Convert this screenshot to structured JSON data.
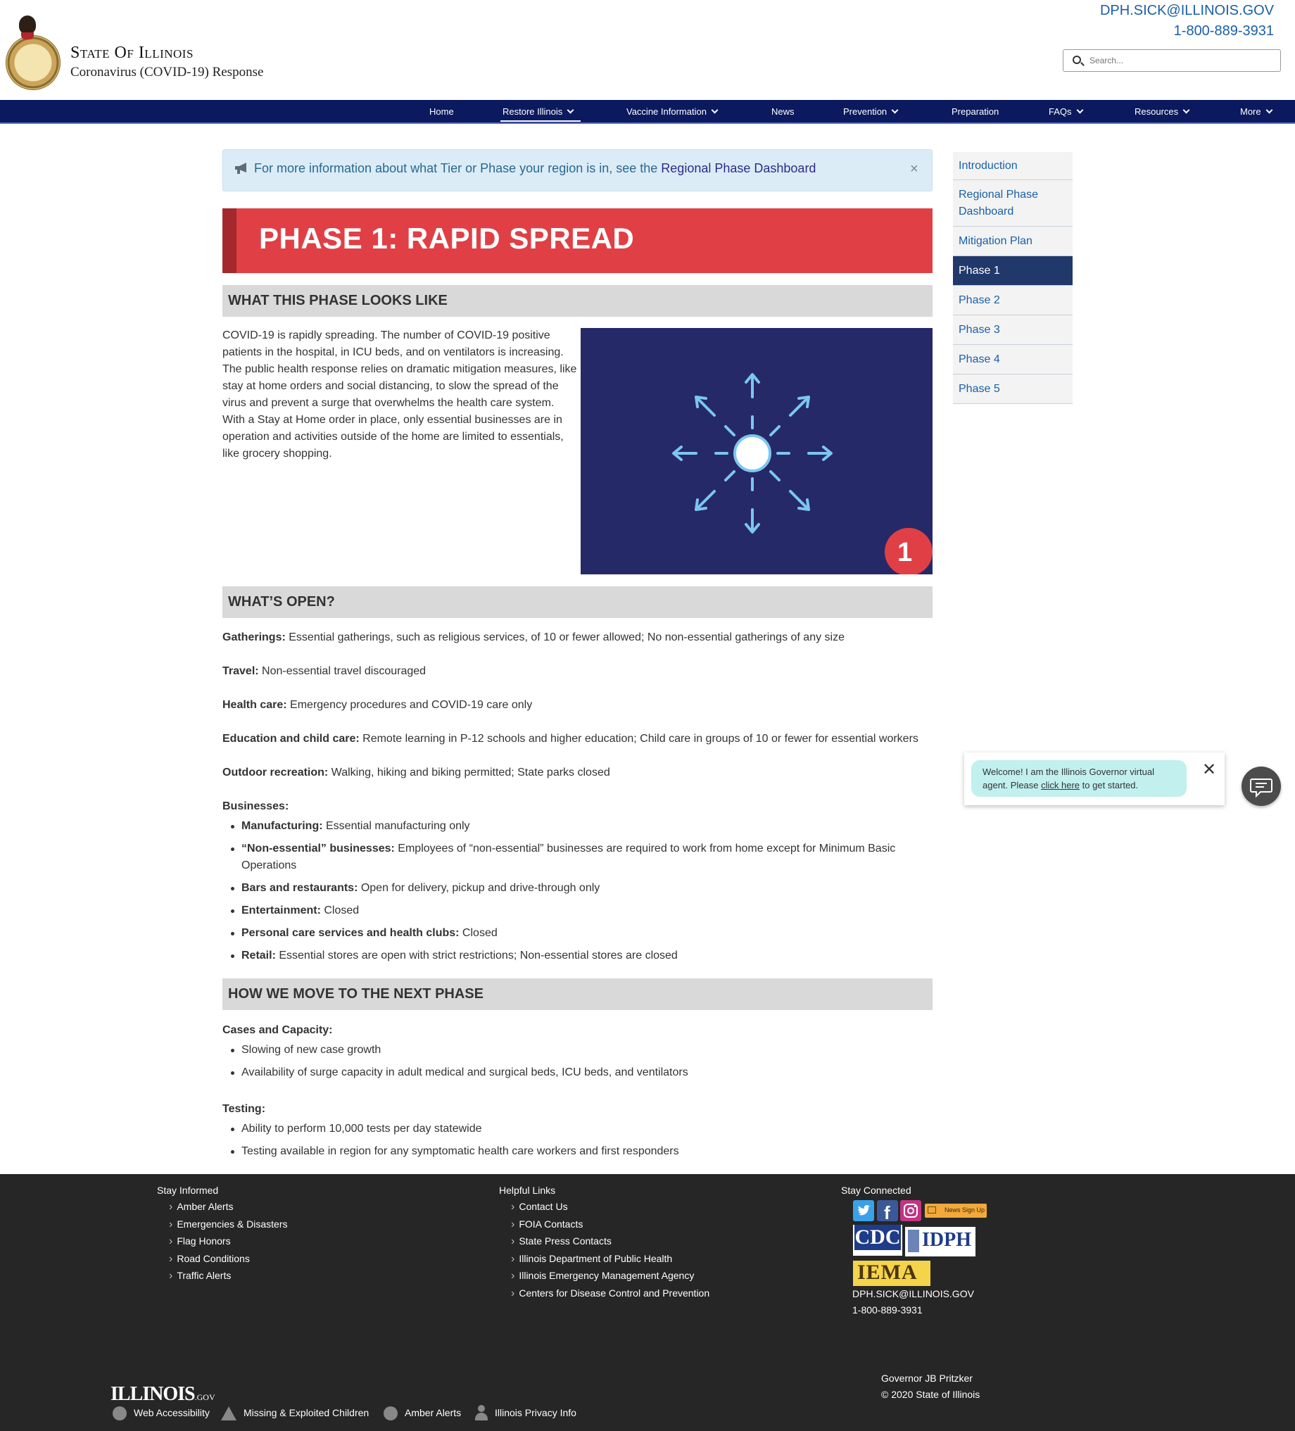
{
  "header": {
    "site_title": "State Of Illinois",
    "site_subtitle": "Coronavirus (COVID-19) Response",
    "contact_email": "DPH.SICK@ILLINOIS.GOV",
    "contact_phone": "1-800-889-3931",
    "search_placeholder": "Search..."
  },
  "nav": {
    "items": [
      {
        "label": "Home"
      },
      {
        "label": "Restore Illinois"
      },
      {
        "label": "Vaccine Information"
      },
      {
        "label": "News"
      },
      {
        "label": "Prevention"
      },
      {
        "label": "Preparation"
      },
      {
        "label": "FAQs"
      },
      {
        "label": "Resources"
      },
      {
        "label": "More"
      }
    ]
  },
  "alert": {
    "text": "For more information about what Tier or Phase your region is in, see the ",
    "link": "Regional Phase Dashboard",
    "close": "×"
  },
  "phase": {
    "title": "PHASE 1: RAPID SPREAD",
    "badge": "1"
  },
  "sections": {
    "looks_like": "WHAT THIS PHASE LOOKS LIKE",
    "whats_open": "WHAT’S OPEN?",
    "next_phase": "HOW WE MOVE TO THE NEXT PHASE"
  },
  "intro": "COVID-19 is rapidly spreading. The number of COVID-19 positive patients in the hospital, in ICU beds, and on ventilators is increasing. The public health response relies on dramatic mitigation measures, like stay at home orders and social distancing, to slow the spread of the virus and prevent a surge that overwhelms the health care system. With a Stay at Home order in place, only essential businesses are in operation and activities outside of the home are limited to essentials, like grocery shopping.",
  "open": {
    "gatherings": {
      "label": "Gatherings:",
      "value": " Essential gatherings, such as religious services, of 10 or fewer allowed; No non-essential gatherings of any size"
    },
    "travel": {
      "label": "Travel:",
      "value": " Non-essential travel discouraged"
    },
    "health": {
      "label": "Health care:",
      "value": " Emergency procedures and COVID-19 care only"
    },
    "education": {
      "label": "Education and child care:",
      "value": " Remote learning in P-12 schools and higher education; Child care in groups of 10 or fewer for essential workers"
    },
    "outdoor": {
      "label": "Outdoor recreation:",
      "value": " Walking, hiking and biking permitted; State parks closed"
    },
    "businesses_label": "Businesses:",
    "businesses": [
      {
        "label": "Manufacturing:",
        "value": " Essential manufacturing only"
      },
      {
        "label": "“Non-essential” businesses:",
        "value": " Employees of “non-essential” businesses are required to work from home except for Minimum Basic Operations"
      },
      {
        "label": "Bars and restaurants:",
        "value": " Open for delivery, pickup and drive-through only"
      },
      {
        "label": "Entertainment:",
        "value": " Closed"
      },
      {
        "label": "Personal care services and health clubs:",
        "value": " Closed"
      },
      {
        "label": "Retail:",
        "value": " Essential stores are open with strict restrictions; Non-essential stores are closed"
      }
    ]
  },
  "next": {
    "cases_label": "Cases and Capacity:",
    "cases": [
      "Slowing of new case growth",
      "Availability of surge capacity in adult medical and surgical beds, ICU beds, and ventilators"
    ],
    "testing_label": "Testing:",
    "testing": [
      "Ability to perform 10,000 tests per day statewide",
      "Testing available in region for any symptomatic health care workers and first responders"
    ]
  },
  "sidenav": {
    "items": [
      {
        "label": "Introduction"
      },
      {
        "label": "Regional Phase Dashboard"
      },
      {
        "label": "Mitigation Plan"
      },
      {
        "label": "Phase 1",
        "active": true
      },
      {
        "label": "Phase 2"
      },
      {
        "label": "Phase 3"
      },
      {
        "label": "Phase 4"
      },
      {
        "label": "Phase 5"
      }
    ]
  },
  "chat": {
    "text_before": "Welcome! I am the Illinois Governor virtual agent. Please ",
    "link": "click here",
    "text_after": " to get started.",
    "close": "✕"
  },
  "footer": {
    "stay_informed": {
      "title": "Stay Informed",
      "links": [
        "Amber Alerts",
        "Emergencies & Disasters",
        "Flag Honors",
        "Road Conditions",
        "Traffic Alerts"
      ]
    },
    "helpful_links": {
      "title": "Helpful Links",
      "links": [
        "Contact Us",
        "FOIA Contacts",
        "State Press Contacts",
        "Illinois Department of Public Health",
        "Illinois Emergency Management Agency",
        "Centers for Disease Control and Prevention"
      ]
    },
    "stay_connected": {
      "title": "Stay Connected",
      "news_signup": "News Sign Up",
      "cdc": "CDC",
      "idph": "IDPH",
      "iema": "IEMA",
      "email": "DPH.SICK@ILLINOIS.GOV",
      "phone": "1-800-889-3931"
    },
    "governor": "Governor JB Pritzker",
    "copyright": "© 2020 State of Illinois",
    "logo_main": "ILLINOIS",
    "logo_suffix": ".GOV",
    "utility": [
      "Web Accessibility",
      "Missing & Exploited Children",
      "Amber Alerts",
      "Illinois Privacy Info"
    ]
  },
  "colors": {
    "nav_bg": "#0b1a5e",
    "phase_red": "#e04045",
    "image_bg": "#262968",
    "link_blue": "#1a5fa8",
    "footer_bg": "#262626"
  }
}
